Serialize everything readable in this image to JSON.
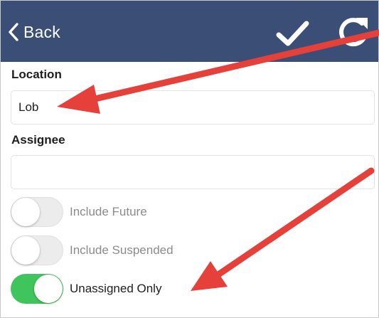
{
  "navbar": {
    "back_label": "Back",
    "background": "#3b4e75"
  },
  "form": {
    "location": {
      "label": "Location",
      "value": "Lob"
    },
    "assignee": {
      "label": "Assignee",
      "value": ""
    }
  },
  "toggles": [
    {
      "label": "Include Future",
      "on": false
    },
    {
      "label": "Include Suspended",
      "on": false
    },
    {
      "label": "Unassigned Only",
      "on": true
    }
  ],
  "colors": {
    "accent_on": "#3fc55b",
    "annotation_arrow": "#e5403a"
  },
  "icons": {
    "back": "chevron-left-icon",
    "save": "checkmark-icon",
    "refresh": "refresh-icon"
  }
}
